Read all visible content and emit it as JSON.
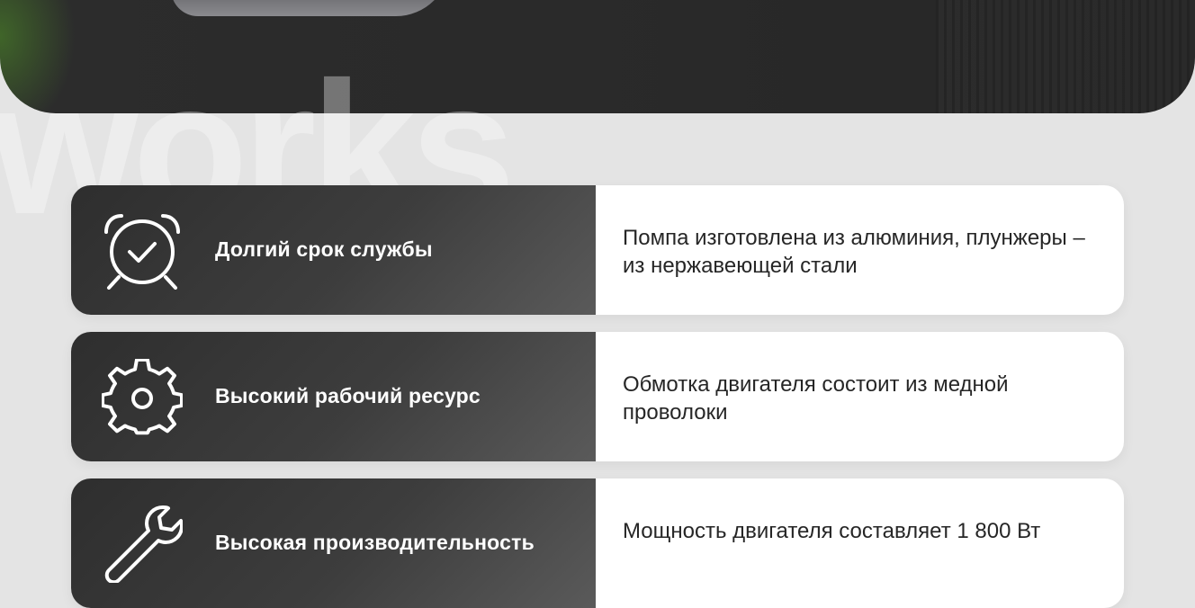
{
  "features": [
    {
      "title": "Долгий срок службы",
      "description": "Помпа изготовлена из алюминия, плунжеры – из нержавеющей стали",
      "icon": "alarm-clock-check-icon"
    },
    {
      "title": "Высокий рабочий ресурс",
      "description": "Обмотка двигателя состоит из медной проволоки",
      "icon": "gear-icon"
    },
    {
      "title": "Высокая производительность",
      "description": "Мощность двигателя составляет 1 800 Вт",
      "icon": "wrench-icon"
    }
  ],
  "watermark": "works",
  "colors": {
    "card_dark": "#3a3a3a",
    "card_light": "#ffffff",
    "page_bg": "#e4e4e4",
    "text_dark": "#262626"
  }
}
